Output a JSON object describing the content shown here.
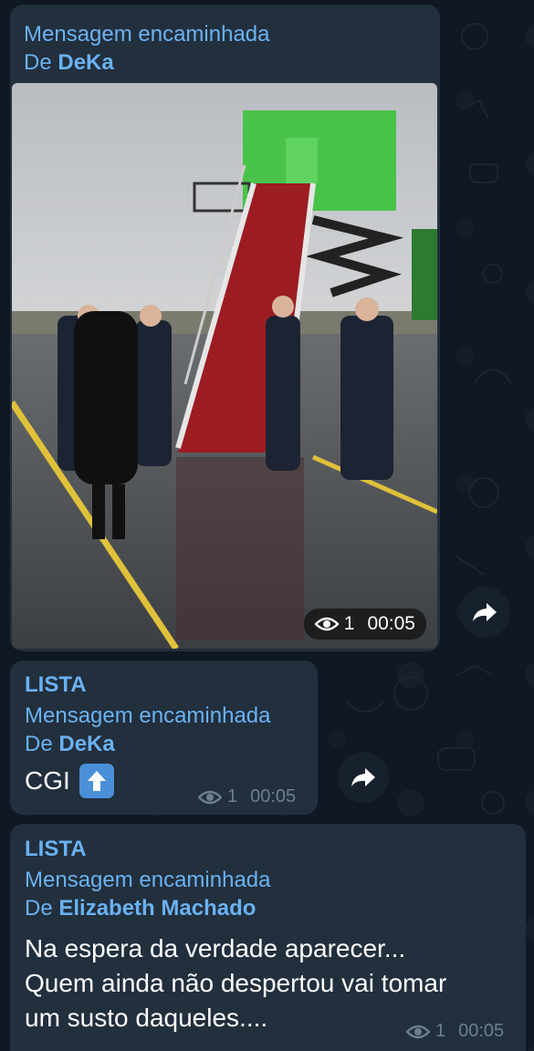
{
  "messages": [
    {
      "forwarded_label": "Mensagem encaminhada",
      "from_prefix": "De",
      "from_name": "DeKa",
      "views": "1",
      "time": "00:05"
    },
    {
      "sender": "LISTA",
      "forwarded_label": "Mensagem encaminhada",
      "from_prefix": "De",
      "from_name": "DeKa",
      "text": "CGI",
      "emoji": "⬆️",
      "views": "1",
      "time": "00:05"
    },
    {
      "sender": "LISTA",
      "forwarded_label": "Mensagem encaminhada",
      "from_prefix": "De",
      "from_name": "Elizabeth Machado",
      "text_lines": [
        "Na espera da verdade aparecer...",
        "Quem ainda não despertou vai tomar",
        "um susto daqueles...."
      ],
      "views": "1",
      "time": "00:05"
    }
  ],
  "icons": {
    "views": "eye-icon",
    "share": "share-arrow-icon",
    "emoji": "up-arrow-emoji"
  },
  "colors": {
    "background": "#0f1823",
    "bubble": "#222f3d",
    "accent": "#6ab2f2",
    "meta": "#6d7f8f"
  }
}
